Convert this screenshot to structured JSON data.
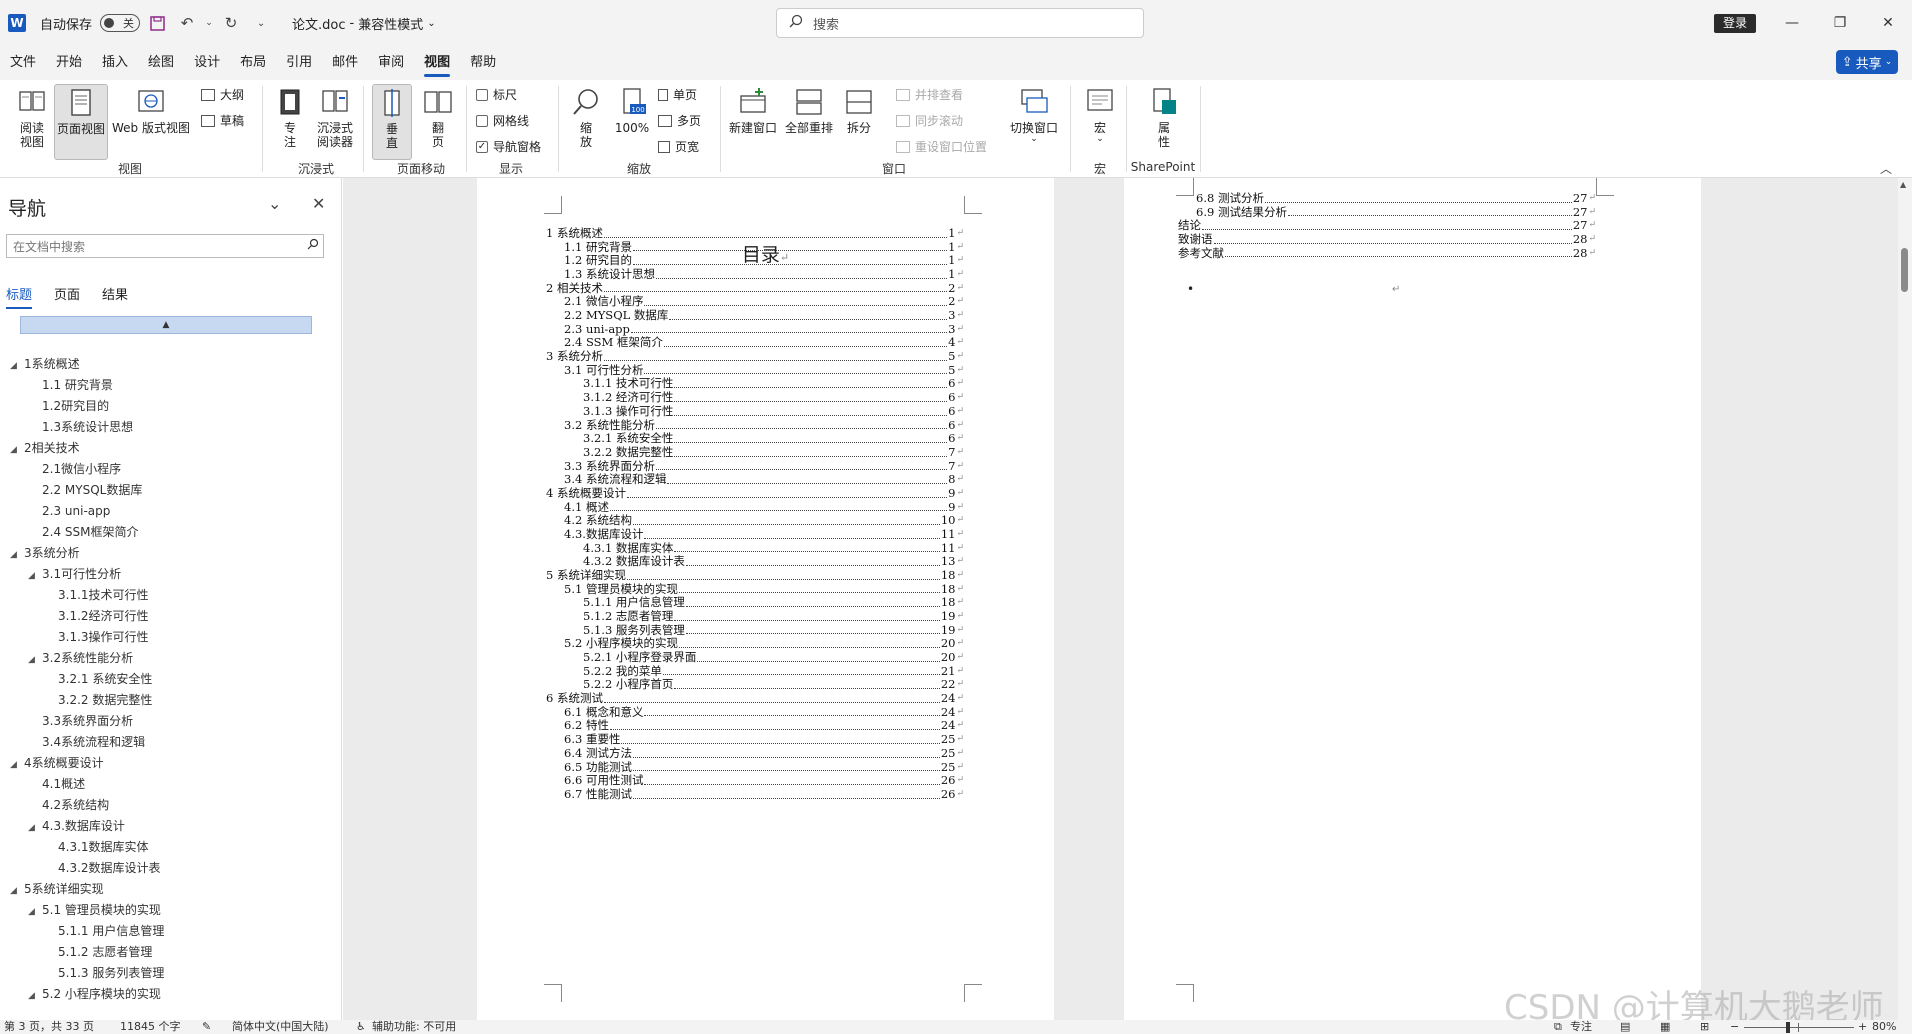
{
  "titlebar": {
    "app_logo": "W",
    "autosave_label": "自动保存",
    "autosave_toggle": "关",
    "save_icon": "save-icon",
    "undo_icon": "undo-icon",
    "redo_icon": "redo-icon",
    "doc_name": "论文.doc",
    "doc_mode": "兼容性模式",
    "search_placeholder": "搜索",
    "login": "登录"
  },
  "menu": {
    "items": [
      "文件",
      "开始",
      "插入",
      "绘图",
      "设计",
      "布局",
      "引用",
      "邮件",
      "审阅",
      "视图",
      "帮助"
    ],
    "active_index": 9,
    "share": "共享"
  },
  "ribbon": {
    "views": {
      "read": "阅读\n视图",
      "print": "页面视图",
      "web": "Web 版式视图",
      "outline": "大纲",
      "draft": "草稿",
      "group": "视图"
    },
    "immersive": {
      "focus": "专\n注",
      "reader": "沉浸式\n阅读器",
      "group": "沉浸式"
    },
    "page_move": {
      "vertical": "垂\n直",
      "side": "翻\n页",
      "group": "页面移动"
    },
    "show": {
      "ruler": "标尺",
      "ruler_checked": false,
      "gridlines": "网格线",
      "gridlines_checked": false,
      "navpane": "导航窗格",
      "navpane_checked": true,
      "group": "显示"
    },
    "zoom": {
      "zoom": "缩\n放",
      "hundred": "100%",
      "one_page": "单页",
      "multi_page": "多页",
      "page_width": "页宽",
      "group": "缩放",
      "hundred_badge": "100"
    },
    "window": {
      "new_window": "新建窗口",
      "arrange_all": "全部重排",
      "split": "拆分",
      "side_by_side": "并排查看",
      "sync_scroll": "同步滚动",
      "reset_pos": "重设窗口位置",
      "switch": "切换窗口",
      "group": "窗口"
    },
    "macros": {
      "macros": "宏",
      "group": "宏"
    },
    "sharepoint": {
      "properties": "属\n性",
      "group": "SharePoint"
    }
  },
  "nav": {
    "title": "导航",
    "search_placeholder": "在文档中搜索",
    "tabs": [
      "标题",
      "页面",
      "结果"
    ],
    "active_tab": 0,
    "items": [
      {
        "label": "1系统概述",
        "level": 1,
        "expanded": true
      },
      {
        "label": "1.1 研究背景",
        "level": 2,
        "expanded": null
      },
      {
        "label": "1.2研究目的",
        "level": 2,
        "expanded": null
      },
      {
        "label": "1.3系统设计思想",
        "level": 2,
        "expanded": null
      },
      {
        "label": "2相关技术",
        "level": 1,
        "expanded": true
      },
      {
        "label": "2.1微信小程序",
        "level": 2,
        "expanded": null
      },
      {
        "label": "2.2 MYSQL数据库",
        "level": 2,
        "expanded": null
      },
      {
        "label": "2.3 uni-app",
        "level": 2,
        "expanded": null
      },
      {
        "label": "2.4 SSM框架简介",
        "level": 2,
        "expanded": null
      },
      {
        "label": "3系统分析",
        "level": 1,
        "expanded": true
      },
      {
        "label": "3.1可行性分析",
        "level": 2,
        "expanded": true
      },
      {
        "label": "3.1.1技术可行性",
        "level": 3,
        "expanded": null
      },
      {
        "label": "3.1.2经济可行性",
        "level": 3,
        "expanded": null
      },
      {
        "label": "3.1.3操作可行性",
        "level": 3,
        "expanded": null
      },
      {
        "label": "3.2系统性能分析",
        "level": 2,
        "expanded": true
      },
      {
        "label": "3.2.1 系统安全性",
        "level": 3,
        "expanded": null
      },
      {
        "label": "3.2.2 数据完整性",
        "level": 3,
        "expanded": null
      },
      {
        "label": "3.3系统界面分析",
        "level": 2,
        "expanded": null
      },
      {
        "label": "3.4系统流程和逻辑",
        "level": 2,
        "expanded": null
      },
      {
        "label": "4系统概要设计",
        "level": 1,
        "expanded": true
      },
      {
        "label": "4.1概述",
        "level": 2,
        "expanded": null
      },
      {
        "label": "4.2系统结构",
        "level": 2,
        "expanded": null
      },
      {
        "label": "4.3.数据库设计",
        "level": 2,
        "expanded": true
      },
      {
        "label": "4.3.1数据库实体",
        "level": 3,
        "expanded": null
      },
      {
        "label": "4.3.2数据库设计表",
        "level": 3,
        "expanded": null
      },
      {
        "label": "5系统详细实现",
        "level": 1,
        "expanded": true
      },
      {
        "label": "5.1 管理员模块的实现",
        "level": 2,
        "expanded": true
      },
      {
        "label": "5.1.1 用户信息管理",
        "level": 3,
        "expanded": null
      },
      {
        "label": "5.1.2 志愿者管理",
        "level": 3,
        "expanded": null
      },
      {
        "label": "5.1.3 服务列表管理",
        "level": 3,
        "expanded": null
      },
      {
        "label": "5.2 小程序模块的实现",
        "level": 2,
        "expanded": true
      }
    ]
  },
  "page1": {
    "toc_title": "目录",
    "entries": [
      {
        "text": "1 系统概述",
        "page": "1",
        "level": 0
      },
      {
        "text": "1.1  研究背景",
        "page": "1",
        "level": 1
      },
      {
        "text": "1.2 研究目的",
        "page": "1",
        "level": 1
      },
      {
        "text": "1.3 系统设计思想",
        "page": "1",
        "level": 1
      },
      {
        "text": "2 相关技术",
        "page": "2",
        "level": 0
      },
      {
        "text": "2.1 微信小程序",
        "page": "2",
        "level": 1
      },
      {
        "text": "2.2 MYSQL 数据库",
        "page": "3",
        "level": 1
      },
      {
        "text": "2.3 uni-app",
        "page": "3",
        "level": 1
      },
      {
        "text": "2.4 SSM 框架简介",
        "page": "4",
        "level": 1
      },
      {
        "text": "3 系统分析",
        "page": "5",
        "level": 0
      },
      {
        "text": "3.1 可行性分析",
        "page": "5",
        "level": 1
      },
      {
        "text": "3.1.1 技术可行性",
        "page": "6",
        "level": 2
      },
      {
        "text": "3.1.2 经济可行性",
        "page": "6",
        "level": 2
      },
      {
        "text": "3.1.3 操作可行性",
        "page": "6",
        "level": 2
      },
      {
        "text": "3.2 系统性能分析",
        "page": "6",
        "level": 1
      },
      {
        "text": "3.2.1  系统安全性",
        "page": "6",
        "level": 2
      },
      {
        "text": "3.2.2  数据完整性",
        "page": "7",
        "level": 2
      },
      {
        "text": "3.3 系统界面分析",
        "page": "7",
        "level": 1
      },
      {
        "text": "3.4 系统流程和逻辑",
        "page": "8",
        "level": 1
      },
      {
        "text": "4 系统概要设计",
        "page": "9",
        "level": 0
      },
      {
        "text": "4.1 概述",
        "page": "9",
        "level": 1
      },
      {
        "text": "4.2 系统结构",
        "page": "10",
        "level": 1
      },
      {
        "text": "4.3.数据库设计",
        "page": "11",
        "level": 1
      },
      {
        "text": "4.3.1 数据库实体",
        "page": "11",
        "level": 2
      },
      {
        "text": "4.3.2 数据库设计表",
        "page": "13",
        "level": 2
      },
      {
        "text": "5 系统详细实现",
        "page": "18",
        "level": 0
      },
      {
        "text": "5.1  管理员模块的实现",
        "page": "18",
        "level": 1
      },
      {
        "text": "5.1.1  用户信息管理",
        "page": "18",
        "level": 2
      },
      {
        "text": "5.1.2  志愿者管理",
        "page": "19",
        "level": 2
      },
      {
        "text": "5.1.3  服务列表管理",
        "page": "19",
        "level": 2
      },
      {
        "text": "5.2  小程序模块的实现",
        "page": "20",
        "level": 1
      },
      {
        "text": "5.2.1  小程序登录界面",
        "page": "20",
        "level": 2
      },
      {
        "text": "5.2.2  我的菜单",
        "page": "21",
        "level": 2
      },
      {
        "text": "5.2.2  小程序首页",
        "page": "22",
        "level": 2
      },
      {
        "text": "6 系统测试",
        "page": "24",
        "level": 0
      },
      {
        "text": "6.1 概念和意义",
        "page": "24",
        "level": 1
      },
      {
        "text": "6.2 特性",
        "page": "24",
        "level": 1
      },
      {
        "text": "6.3 重要性",
        "page": "25",
        "level": 1
      },
      {
        "text": "6.4 测试方法",
        "page": "25",
        "level": 1
      },
      {
        "text": "6.5  功能测试",
        "page": "25",
        "level": 1
      },
      {
        "text": "6.6 可用性测试",
        "page": "26",
        "level": 1
      },
      {
        "text": "6.7 性能测试",
        "page": "26",
        "level": 1
      }
    ]
  },
  "page2": {
    "entries": [
      {
        "text": "6.8 测试分析",
        "page": "27",
        "level": 1
      },
      {
        "text": "6.9 测试结果分析",
        "page": "27",
        "level": 1
      },
      {
        "text": "结论",
        "page": "27",
        "level": 0
      },
      {
        "text": "致谢语",
        "page": "28",
        "level": 0
      },
      {
        "text": "参考文献",
        "page": "28",
        "level": 0
      }
    ],
    "bullet": "•",
    "return_mark": "↵"
  },
  "status": {
    "page": "第 3 页，共 33 页",
    "words": "11845 个字",
    "lang": "简体中文(中国大陆)",
    "access": "辅助功能: 不可用",
    "focus": "专注",
    "zoom": "80%",
    "zoom_level": 0.8
  },
  "watermark": "CSDN @计算机大鹅老师",
  "colors": {
    "accent": "#185abd",
    "nav_scroll": "#c6d9f1",
    "doc_bg": "#ebebeb"
  }
}
